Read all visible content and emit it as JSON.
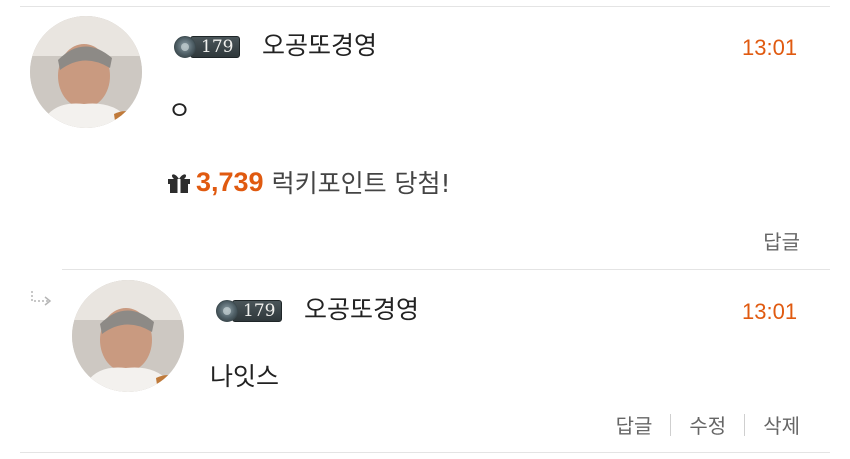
{
  "comments": [
    {
      "level": "179",
      "username": "오공또경영",
      "time": "13:01",
      "text": "ㅇ",
      "lucky_points": "3,739",
      "lucky_text": "럭키포인트 당첨!",
      "actions": [
        "답글"
      ]
    },
    {
      "level": "179",
      "username": "오공또경영",
      "time": "13:01",
      "text": "나잇스",
      "actions": [
        "답글",
        "수정",
        "삭제"
      ]
    }
  ],
  "colors": {
    "accent": "#e05a10",
    "text": "#222222",
    "muted": "#666666",
    "divider": "#e4e4e4"
  },
  "icons": {
    "gift": "gift-icon",
    "reply": "reply-arrow-icon",
    "level_emblem": "level-emblem-icon"
  }
}
